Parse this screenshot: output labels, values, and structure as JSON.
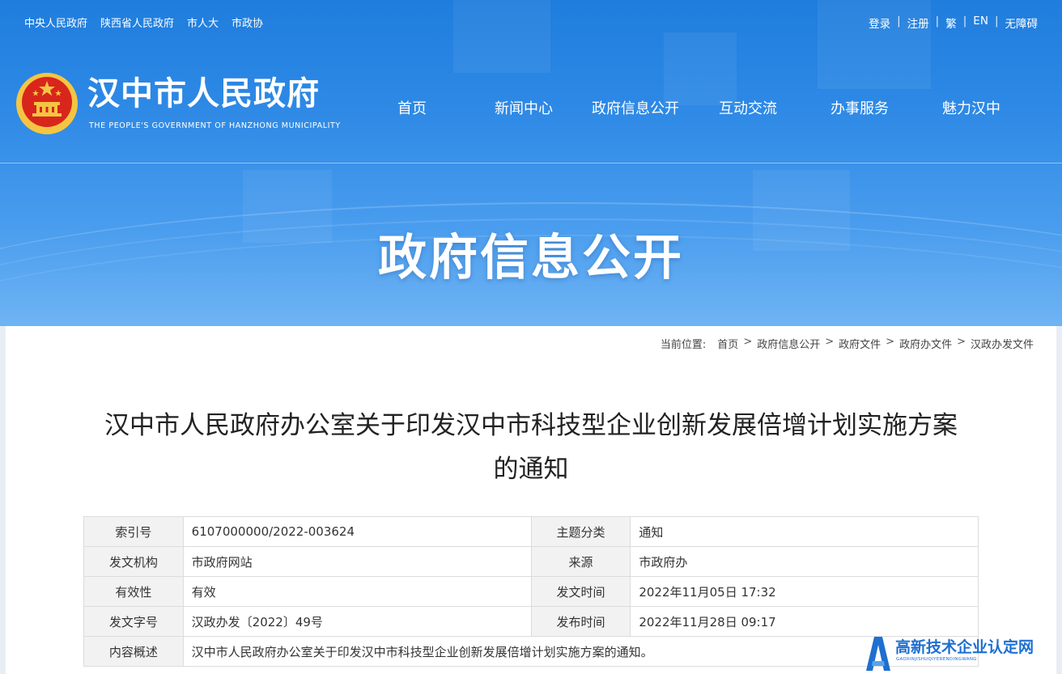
{
  "top_links": [
    "中央人民政府",
    "陕西省人民政府",
    "市人大",
    "市政协"
  ],
  "user_links": [
    "登录",
    "注册",
    "繁",
    "EN",
    "无障碍"
  ],
  "site": {
    "title": "汉中市人民政府",
    "subtitle": "THE PEOPLE'S GOVERNMENT OF HANZHONG MUNICIPALITY"
  },
  "nav": [
    "首页",
    "新闻中心",
    "政府信息公开",
    "互动交流",
    "办事服务",
    "魅力汉中"
  ],
  "banner_title": "政府信息公开",
  "breadcrumb": {
    "label": "当前位置:",
    "items": [
      "首页",
      "政府信息公开",
      "政府文件",
      "政府办文件",
      "汉政办发文件"
    ],
    "separator": ">"
  },
  "document": {
    "title_line1": "汉中市人民政府办公室关于印发汉中市科技型企业创新发展倍增计划实施方案",
    "title_line2": "的通知",
    "meta": {
      "index_no_label": "索引号",
      "index_no": "6107000000/2022-003624",
      "topic_label": "主题分类",
      "topic": "通知",
      "issuer_label": "发文机构",
      "issuer": "市政府网站",
      "source_label": "来源",
      "source": "市政府办",
      "validity_label": "有效性",
      "validity": "有效",
      "issue_time_label": "发文时间",
      "issue_time": "2022年11月05日 17:32",
      "doc_no_label": "发文字号",
      "doc_no": "汉政办发〔2022〕49号",
      "publish_time_label": "发布时间",
      "publish_time": "2022年11月28日 09:17",
      "summary_label": "内容概述",
      "summary": "汉中市人民政府办公室关于印发汉中市科技型企业创新发展倍增计划实施方案的通知。"
    }
  },
  "watermark": {
    "text": "高新技术企业认定网",
    "sub": "GAOXINJISHUQIYERENDINGWANG"
  },
  "colors": {
    "banner_top": "#1f7ddd",
    "banner_bottom": "#6fb4f4",
    "emblem_red": "#d8261c",
    "emblem_gold": "#f5c542",
    "watermark_blue": "#1e6fd0"
  }
}
